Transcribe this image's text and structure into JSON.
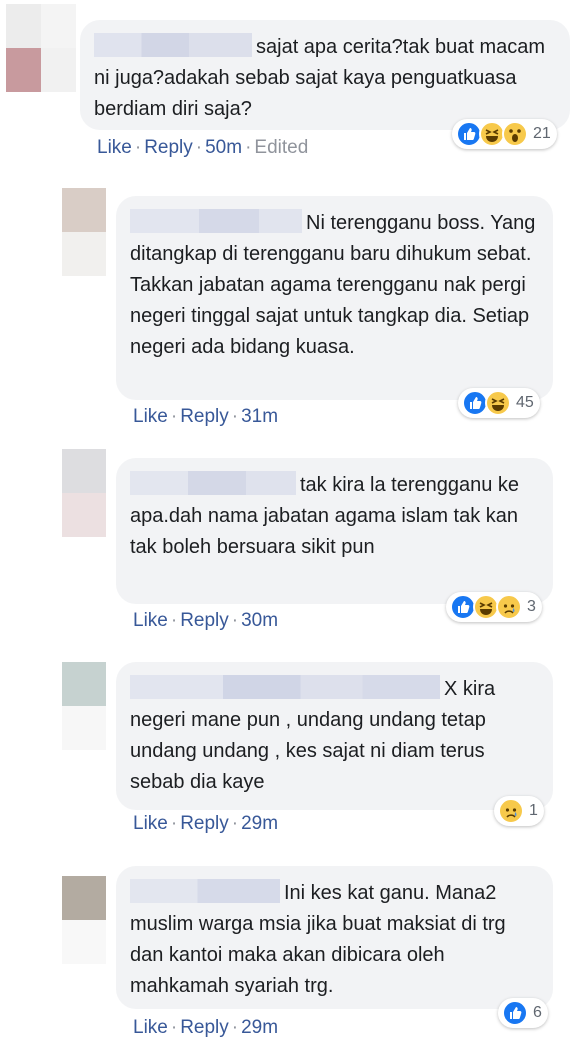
{
  "comments": [
    {
      "text": "sajat apa cerita?tak buat macam ni juga?adakah sebab sajat kaya penguatkuasa berdiam diri saja?",
      "reactions": [
        "like",
        "haha",
        "wow"
      ],
      "reaction_count": "21",
      "like_label": "Like",
      "reply_label": "Reply",
      "time": "50m",
      "edited": "Edited"
    },
    {
      "text": "Ni terengganu boss. Yang ditangkap di terengganu baru dihukum sebat. Takkan jabatan agama terengganu nak pergi negeri tinggal sajat untuk tangkap dia. Setiap negeri ada bidang kuasa.",
      "reactions": [
        "like",
        "haha"
      ],
      "reaction_count": "45",
      "like_label": "Like",
      "reply_label": "Reply",
      "time": "31m"
    },
    {
      "text": "tak kira la terengganu ke apa.dah nama jabatan agama islam tak kan tak boleh bersuara sikit pun",
      "reactions": [
        "like",
        "haha",
        "sad"
      ],
      "reaction_count": "3",
      "like_label": "Like",
      "reply_label": "Reply",
      "time": "30m"
    },
    {
      "text": "X kira negeri mane pun , undang undang tetap undang undang , kes sajat ni diam terus sebab dia kaye",
      "reactions": [
        "sad"
      ],
      "reaction_count": "1",
      "like_label": "Like",
      "reply_label": "Reply",
      "time": "29m"
    },
    {
      "text": "Ini kes kat ganu. Mana2 muslim warga msia jika buat maksiat di trg dan kantoi maka akan dibicara oleh mahkamah syariah trg.",
      "reactions": [
        "like"
      ],
      "reaction_count": "6",
      "like_label": "Like",
      "reply_label": "Reply",
      "time": "29m"
    }
  ],
  "colors": {
    "link": "#385898",
    "meta": "#90949c",
    "bubble": "#f2f3f5",
    "text": "#1c1e21",
    "like_blue": "#1877f2",
    "emoji_yellow": "#f7c94b"
  },
  "separator": "·"
}
